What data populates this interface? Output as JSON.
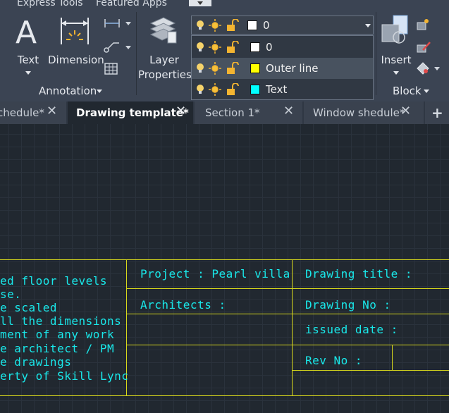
{
  "menu": {
    "express_tools": "Express Tools",
    "featured_apps": "Featured Apps"
  },
  "ribbon": {
    "text_label": "Text",
    "dimension_label": "Dimension",
    "annotation_panel": "Annotation",
    "layer_properties_line1": "Layer",
    "layer_properties_line2": "Properties",
    "insert_label": "Insert",
    "block_panel": "Block"
  },
  "layer_dropdown": {
    "current": {
      "name": "0",
      "color": "#ffffff"
    },
    "items": [
      {
        "name": "0",
        "color": "#ffffff"
      },
      {
        "name": "Outer line",
        "color": "#ffff00"
      },
      {
        "name": "Text",
        "color": "#00ffff"
      }
    ],
    "highlighted_index": 1
  },
  "tabs": [
    {
      "label": "chedule*",
      "close": "✕"
    },
    {
      "label": "Drawing template*",
      "close": "✕"
    },
    {
      "label": "Section 1*",
      "close": "✕"
    },
    {
      "label": "Window shedule*",
      "close": "✕"
    }
  ],
  "add_tab": "+",
  "drawing": {
    "notes": [
      "ed floor levels",
      "se.",
      "e scaled",
      "ll the dimensions",
      "ment of any work",
      "e architect / PM",
      "e drawings",
      "erty of Skill Lync"
    ],
    "project": "Project : Pearl villa",
    "architects": "Architects :",
    "drawing_title": "Drawing title :",
    "drawing_no": "Drawing No :",
    "issued_date": "issued date :",
    "rev_no": "Rev No :"
  }
}
